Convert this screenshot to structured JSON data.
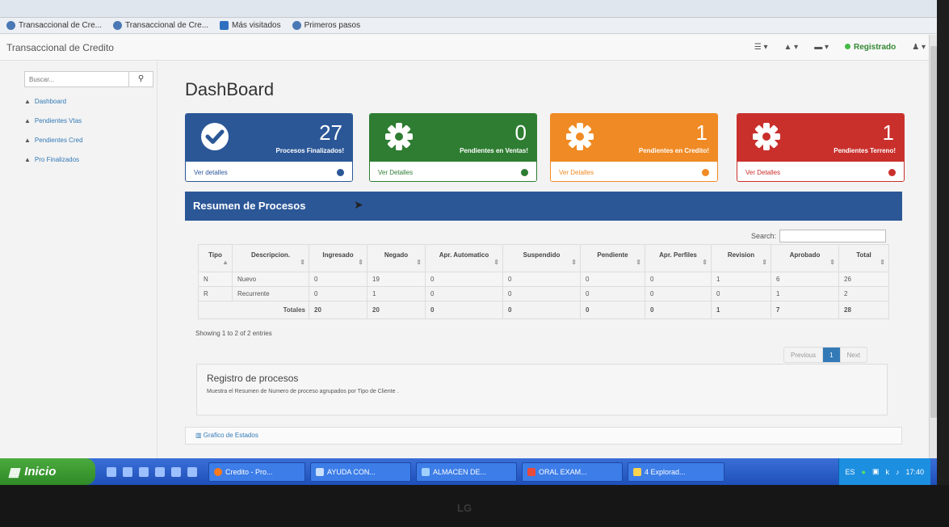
{
  "browser": {
    "bookmarks": [
      {
        "label": "Transaccional de Cre..."
      },
      {
        "label": "Transaccional de Cre..."
      },
      {
        "label": "Más visitados"
      },
      {
        "label": "Primeros pasos"
      }
    ]
  },
  "navbar": {
    "brand": "Transaccional de Credito",
    "status": "Registrado"
  },
  "sidebar": {
    "search_placeholder": "Buscar...",
    "items": [
      {
        "label": "Dashboard"
      },
      {
        "label": "Pendientes Vtas"
      },
      {
        "label": "Pendientes Cred"
      },
      {
        "label": "Pro Finalizados"
      }
    ]
  },
  "main": {
    "title": "DashBoard",
    "panels": [
      {
        "count": "27",
        "label": "Procesos Finalizados!",
        "link": "Ver detalles",
        "color": "#2b5797"
      },
      {
        "count": "0",
        "label": "Pendientes en Ventas!",
        "link": "Ver Detalles",
        "color": "#2e7d32"
      },
      {
        "count": "1",
        "label": "Pendientes en Credito!",
        "link": "Ver Detalles",
        "color": "#f08a24"
      },
      {
        "count": "1",
        "label": "Pendientes Terreno!",
        "link": "Ver Detalles",
        "color": "#c9302c"
      }
    ],
    "resumen_title": "Resumen de Procesos",
    "search_label": "Search:",
    "table": {
      "headers": [
        "Tipo",
        "Descripcion.",
        "Ingresado",
        "Negado",
        "Apr. Automatico",
        "Suspendido",
        "Pendiente",
        "Apr. Perfiles",
        "Revision",
        "Aprobado",
        "Total"
      ],
      "rows": [
        [
          "N",
          "Nuevo",
          "0",
          "19",
          "0",
          "0",
          "0",
          "0",
          "1",
          "6",
          "26"
        ],
        [
          "R",
          "Recurrente",
          "0",
          "1",
          "0",
          "0",
          "0",
          "0",
          "0",
          "1",
          "2"
        ]
      ],
      "totals_label": "Totales",
      "totals": [
        "20",
        "20",
        "0",
        "0",
        "0",
        "0",
        "1",
        "7",
        "28"
      ]
    },
    "showing": "Showing 1 to 2 of 2 entries",
    "pager": {
      "previous": "Previous",
      "current": "1",
      "next": "Next"
    },
    "registro": {
      "title": "Registro de procesos",
      "description": "Muestra el Resumen de Numero de proceso agrupados por Tipo de Cliente ."
    },
    "graficos": "Grafico de Estados"
  },
  "taskbar": {
    "start": "Inicio",
    "buttons": [
      {
        "label": "Credito - Pro..."
      },
      {
        "label": "AYUDA CON..."
      },
      {
        "label": "ALMACEN DE..."
      },
      {
        "label": "ORAL EXAM..."
      },
      {
        "label": "4 Explorad..."
      }
    ],
    "language": "ES",
    "time": "17:40"
  },
  "monitor": {
    "brand": "LG"
  }
}
